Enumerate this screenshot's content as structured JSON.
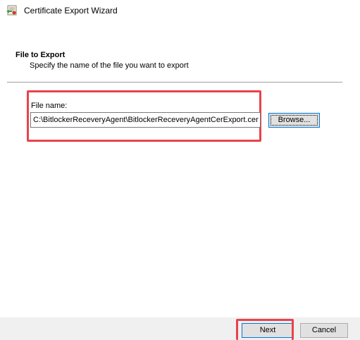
{
  "window": {
    "title": "Certificate Export Wizard",
    "icon": "certificate-wizard-icon"
  },
  "header": {
    "title": "File to Export",
    "subtitle": "Specify the name of the file you want to export"
  },
  "form": {
    "file_name_label": "File name:",
    "file_name_value": "C:\\BitlockerReceveryAgent\\BitlockerReceveryAgentCerExport.cer",
    "browse_label": "Browse..."
  },
  "footer": {
    "next_label": "Next",
    "cancel_label": "Cancel"
  },
  "colors": {
    "highlight": "#e8434a",
    "focus_border": "#0078d7",
    "button_face": "#e1e1e1",
    "footer_bg": "#f0f0f0"
  }
}
